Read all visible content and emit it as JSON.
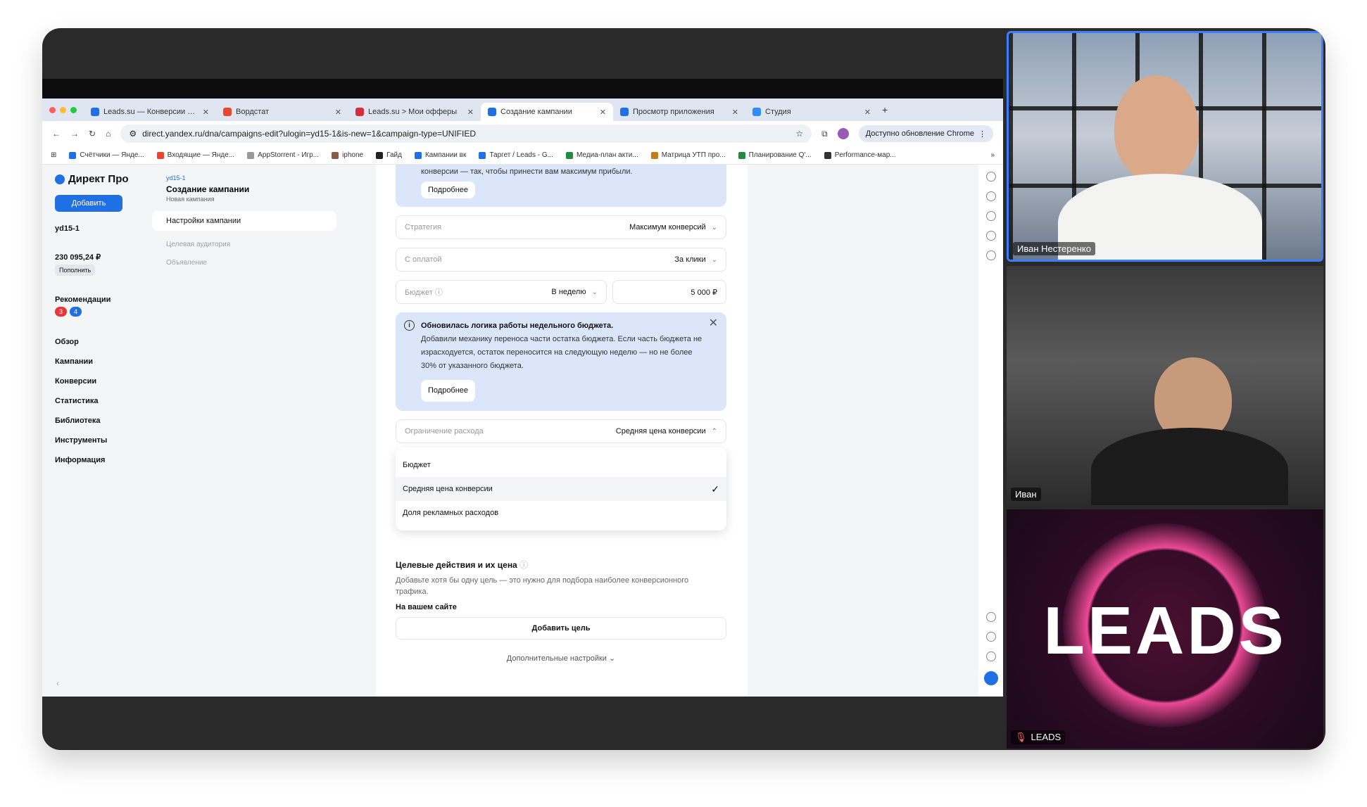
{
  "browser": {
    "tabs": [
      {
        "title": "Leads.su — Конверсии — Я",
        "color": "#1f6fe5"
      },
      {
        "title": "Вордстат",
        "color": "#e8462f"
      },
      {
        "title": "Leads.su > Мои офферы",
        "color": "#d62d3a"
      },
      {
        "title": "Создание кампании",
        "color": "#1f6fe5"
      },
      {
        "title": "Просмотр приложения",
        "color": "#1f6fe5"
      },
      {
        "title": "Студия",
        "color": "#2d8cff"
      }
    ],
    "url": "direct.yandex.ru/dna/campaigns-edit?ulogin=yd15-1&is-new=1&campaign-type=UNIFIED",
    "update_label": "Доступно обновление Chrome",
    "bookmarks": [
      "Счётчики — Янде...",
      "Входящие — Янде...",
      "AppStorrent - Игр...",
      "iphone",
      "Гайд",
      "Кампании вк",
      "Таргет / Leads - G...",
      "Медиа-план акти...",
      "Матрица УТП про...",
      "Планирование Q'...",
      "Performance-мар..."
    ]
  },
  "leftnav": {
    "logo": "Директ Про",
    "add_button": "Добавить",
    "account": "yd15-1",
    "balance": "230 095,24 ₽",
    "topup": "Пополнить",
    "recommendations": "Рекомендации",
    "badge_red": "3",
    "badge_blue": "4",
    "items": [
      "Обзор",
      "Кампании",
      "Конверсии",
      "Статистика",
      "Библиотека",
      "Инструменты",
      "Информация"
    ]
  },
  "midnav": {
    "crumb": "yd15-1",
    "title": "Создание кампании",
    "subtitle": "Новая кампания",
    "steps": [
      "Настройки кампании",
      "Целевая аудитория",
      "Объявление"
    ]
  },
  "form": {
    "top_info_text": "конверсии — так, чтобы принести вам максимум прибыли.",
    "more_label": "Подробнее",
    "strategy_label": "Стратегия",
    "strategy_value": "Максимум конверсий",
    "payment_label": "С оплатой",
    "payment_value": "За клики",
    "budget_label": "Бюджет",
    "budget_period": "В неделю",
    "budget_value": "5 000 ₽",
    "notice_title": "Обновилась логика работы недельного бюджета.",
    "notice_text": "Добавили механику переноса части остатка бюджета. Если часть бюджета не израсходуется, остаток переносится на следующую неделю — но не более 30% от указанного бюджета.",
    "notice_more": "Подробнее",
    "limit_label": "Ограничение расхода",
    "limit_value": "Средняя цена конверсии",
    "options": [
      "Бюджет",
      "Средняя цена конверсии",
      "Доля рекламных расходов"
    ],
    "goals_title": "Целевые действия и их цена",
    "goals_desc": "Добавьте хотя бы одну цель — это нужно для подбора наиболее конверсионного трафика.",
    "on_site": "На вашем сайте",
    "add_goal": "Добавить цель",
    "advanced": "Дополнительные настройки"
  },
  "video": {
    "participant1": "Иван Нестеренко",
    "participant2": "Иван",
    "participant3": "LEADS",
    "logo_text": "LEADS"
  }
}
